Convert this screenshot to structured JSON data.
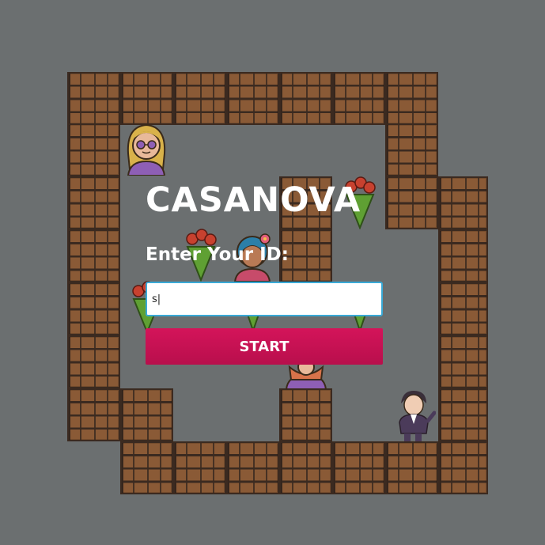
{
  "game": {
    "title": "CASANOVA",
    "id_label": "Enter Your ID:",
    "id_input_value": "s|",
    "start_label": "START"
  },
  "colors": {
    "background": "#6b6f70",
    "brick": "#8a5a36",
    "brick_mortar": "#3b2a20",
    "input_border": "#39a9d6",
    "start_button": "#c8124f",
    "text": "#ffffff"
  },
  "sprites": {
    "characters": [
      "blonde-girl-with-glasses",
      "girl-with-blue-hair-and-flower",
      "girl-with-orange-hair",
      "casanova-player-in-suit"
    ],
    "items": [
      "rose-bouquet",
      "rose-bouquet",
      "rose-bouquet",
      "rose-bouquet",
      "rose-bouquet"
    ]
  }
}
